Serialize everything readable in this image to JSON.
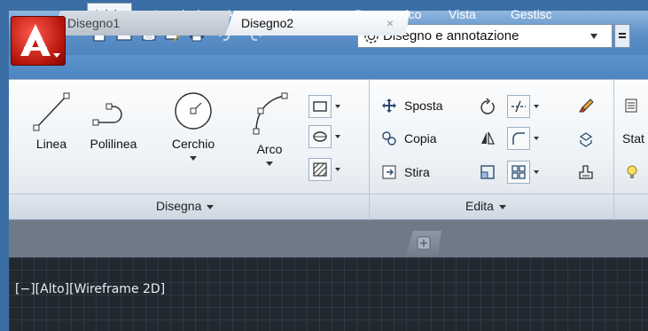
{
  "workspace": {
    "label": "Disegno e annotazione"
  },
  "tabs": [
    {
      "label": "Inizio",
      "active": true
    },
    {
      "label": "Inserisci"
    },
    {
      "label": "Annota"
    },
    {
      "label": "Layout"
    },
    {
      "label": "Parametrico"
    },
    {
      "label": "Vista"
    },
    {
      "label": "Gestisc"
    }
  ],
  "panels": {
    "disegna": {
      "title": "Disegna",
      "linea": "Linea",
      "polilinea": "Polilinea",
      "cerchio": "Cerchio",
      "arco": "Arco"
    },
    "edita": {
      "title": "Edita",
      "sposta": "Sposta",
      "copia": "Copia",
      "stira": "Stira"
    },
    "layers": {
      "stat": "Stat"
    }
  },
  "doc_tabs": [
    {
      "label": "Disegno1"
    },
    {
      "label": "Disegno2",
      "active": true
    }
  ],
  "doc_close": "×",
  "viewport": {
    "controls": "[−][Alto][Wireframe 2D]"
  },
  "colors": {
    "accent": "#4d84bf",
    "app_button": "#c4160d",
    "canvas": "#212830"
  }
}
